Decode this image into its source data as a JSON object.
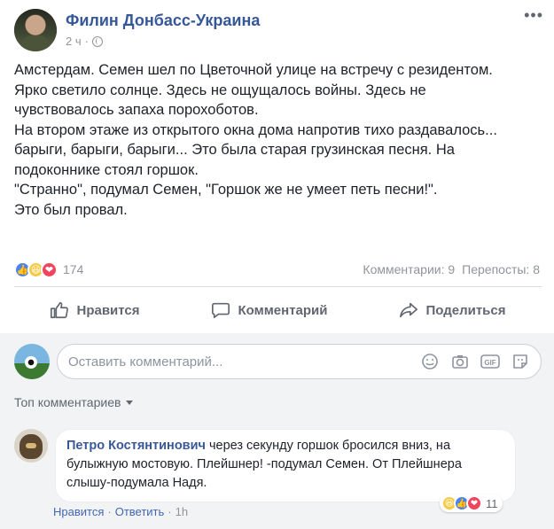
{
  "post": {
    "page_name": "Филин Донбасс-Украина",
    "time": "2 ч",
    "dot": "·",
    "more": "•••",
    "text_lines": [
      "Амстердам. Семен шел по Цветочной улице на встречу с резидентом.",
      "Ярко светило солнце. Здесь не ощущалось войны. Здесь не",
      "чувствовалось запаха порохоботов.",
      "На втором этаже из открытого окна дома напротив тихо раздавалось...",
      "барыги, барыги, барыги... Это была старая грузинская песня. На",
      "подоконнике стоял горшок.",
      "\"Странно\", подумал Семен, \"Горшок же не умеет петь песни!\".",
      "Это был провал."
    ]
  },
  "reactions": {
    "count": "174",
    "comments": "Комментарии: 9",
    "shares": "Перепосты: 8",
    "icons": [
      "like-icon",
      "haha-icon",
      "love-icon"
    ]
  },
  "actions": {
    "like": "Нравится",
    "comment": "Комментарий",
    "share": "Поделиться"
  },
  "composer": {
    "placeholder": "Оставить комментарий...",
    "icons": [
      "emoji-icon",
      "camera-icon",
      "gif-icon",
      "sticker-icon"
    ]
  },
  "comments_section": {
    "sort_label": "Топ комментариев"
  },
  "comment": {
    "author": "Петро Костянтинович",
    "text": " через секунду горшок бросился вниз, на булыжную мостовую. Плейшнер! -подумал Семен. От Плейшнера слышу-подумала Надя.",
    "reaction_count": "11",
    "like": "Нравится",
    "reply": "Ответить",
    "time": "1h",
    "sep": "·"
  },
  "colors": {
    "link": "#365899",
    "muted": "#90949c",
    "like": "#4a84f0",
    "love": "#f0455e",
    "haha": "#f7c842"
  }
}
